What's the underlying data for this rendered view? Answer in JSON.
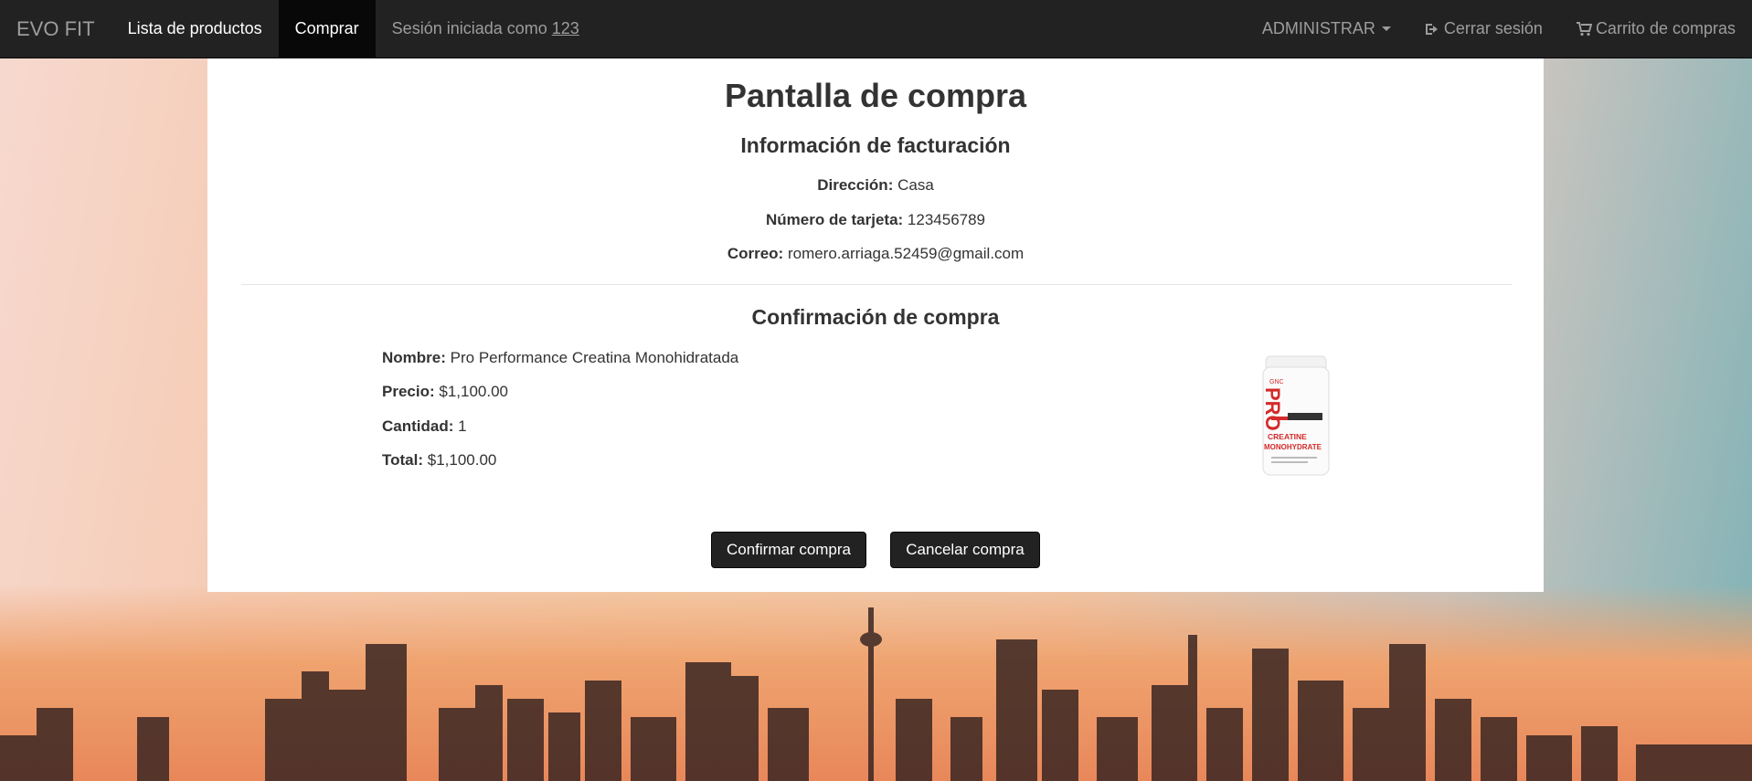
{
  "navbar": {
    "brand": "EVO FIT",
    "items": [
      {
        "label": "Lista de productos",
        "active": false
      },
      {
        "label": "Comprar",
        "active": true
      }
    ],
    "session_text": "Sesión iniciada como",
    "session_user": "123",
    "admin_label": "ADMINISTRAR",
    "logout_label": "Cerrar sesión",
    "cart_label": "Carrito de compras"
  },
  "page": {
    "title": "Pantalla de compra",
    "billing": {
      "heading": "Información de facturación",
      "address_label": "Dirección:",
      "address_value": "Casa",
      "card_label": "Número de tarjeta:",
      "card_value": "123456789",
      "email_label": "Correo:",
      "email_value": "romero.arriaga.52459@gmail.com"
    },
    "confirmation": {
      "heading": "Confirmación de compra",
      "name_label": "Nombre:",
      "name_value": "Pro Performance Creatina Monohidratada",
      "price_label": "Precio:",
      "price_value": "$1,100.00",
      "qty_label": "Cantidad:",
      "qty_value": "1",
      "total_label": "Total:",
      "total_value": "$1,100.00"
    },
    "product_image": {
      "brand": "GNC",
      "line1": "PRO",
      "line2": "CREATINE",
      "line3": "MONOHYDRATE"
    },
    "buttons": {
      "confirm": "Confirmar compra",
      "cancel": "Cancelar compra"
    }
  },
  "colors": {
    "navbar_bg": "#222222",
    "active_nav_bg": "#080808",
    "button_bg": "#222222",
    "product_red": "#d42a2a"
  }
}
